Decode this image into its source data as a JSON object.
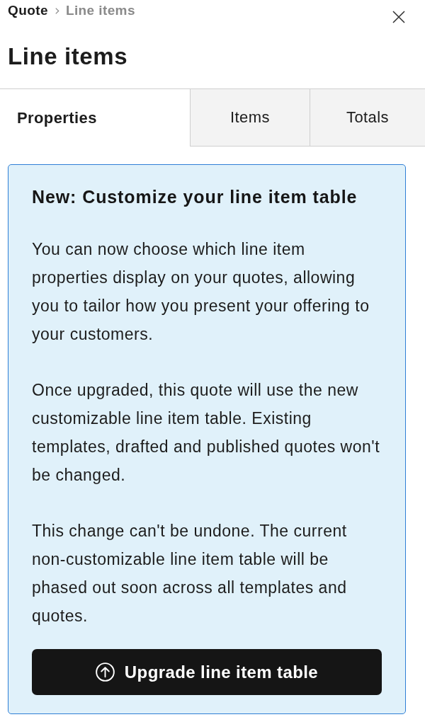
{
  "breadcrumb": [
    {
      "label": "Quote",
      "current": false
    },
    {
      "label": "Line items",
      "current": true
    }
  ],
  "title": "Line items",
  "tabs": [
    {
      "label": "Properties",
      "selected": true
    },
    {
      "label": "Items",
      "selected": false
    },
    {
      "label": "Totals",
      "selected": false
    }
  ],
  "notice": {
    "heading": "New: Customize your line item table",
    "paragraphs": [
      "You can now choose which line item properties display on your quotes, allowing you to tailor how you present your offering to your customers.",
      "Once upgraded, this quote will use the new customizable line item table. Existing templates, drafted and published quotes won't be changed.",
      "This change can't be undone. The current non-customizable line item table will be phased out soon across all templates and quotes."
    ],
    "button": {
      "label": "Upgrade line item table"
    }
  }
}
